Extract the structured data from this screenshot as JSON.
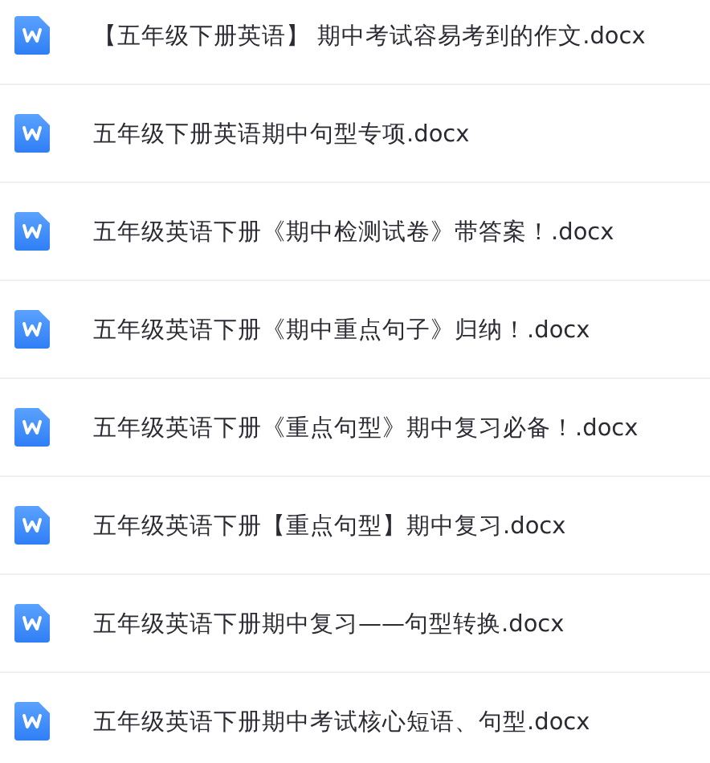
{
  "files": [
    {
      "name": "【五年级下册英语】 期中考试容易考到的作文.docx"
    },
    {
      "name": "五年级下册英语期中句型专项.docx"
    },
    {
      "name": "五年级英语下册《期中检测试卷》带答案！.docx"
    },
    {
      "name": "五年级英语下册《期中重点句子》归纳！.docx"
    },
    {
      "name": "五年级英语下册《重点句型》期中复习必备！.docx"
    },
    {
      "name": "五年级英语下册【重点句型】期中复习.docx"
    },
    {
      "name": "五年级英语下册期中复习——句型转换.docx"
    },
    {
      "name": "五年级英语下册期中考试核心短语、句型.docx"
    }
  ]
}
